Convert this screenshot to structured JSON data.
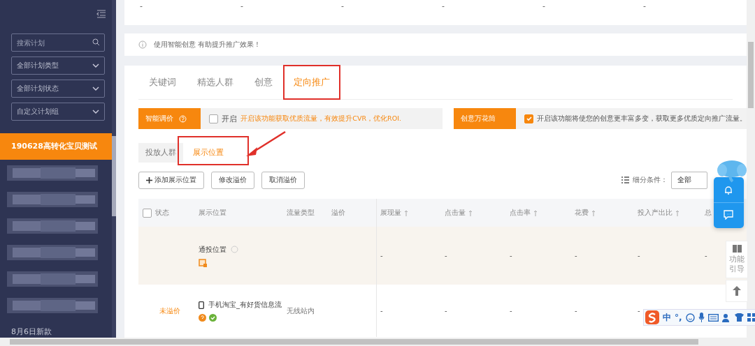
{
  "sidebar": {
    "search": {
      "placeholder": "搜索计划"
    },
    "filters": [
      "全部计划类型",
      "全部计划状态",
      "自定义计划组"
    ],
    "campaigns": [
      {
        "kind": "text",
        "name": "190628高转化宝贝测试",
        "selected": true
      },
      {
        "kind": "redacted"
      },
      {
        "kind": "redacted"
      },
      {
        "kind": "redacted"
      },
      {
        "kind": "redacted"
      },
      {
        "kind": "redacted"
      },
      {
        "kind": "redacted"
      },
      {
        "kind": "text",
        "name": "8月6日新款",
        "selected": false
      }
    ]
  },
  "summary_values": [
    "-",
    "-",
    "-",
    "-",
    "-",
    "-"
  ],
  "notice": "使用智能创意 有助提升推广效果！",
  "tabs": [
    {
      "label": "关键词",
      "selected": false
    },
    {
      "label": "精选人群",
      "selected": false
    },
    {
      "label": "创意",
      "selected": false
    },
    {
      "label": "定向推广",
      "selected": true
    }
  ],
  "smart_bid": {
    "label": "智能调价",
    "enabled": false,
    "toggle_label": "开启",
    "hint": "开启该功能获取优质流量，有效提升CVR，优化ROI."
  },
  "creative_kaleidoscope": {
    "label": "创意万花筒",
    "enabled": true,
    "hint": "开启该功能将使您的创意更丰富多变，获取更多优质定向推广流量。"
  },
  "sub_tabs": [
    {
      "label": "投放人群",
      "selected": false
    },
    {
      "label": "展示位置",
      "selected": true
    }
  ],
  "actions": [
    {
      "kind": "add",
      "label": "添加展示位置"
    },
    {
      "kind": "plain",
      "label": "修改溢价"
    },
    {
      "kind": "plain",
      "label": "取消溢价"
    }
  ],
  "segment": {
    "label": "细分条件：",
    "value": "全部"
  },
  "table": {
    "select_all_checked": false,
    "columns": [
      {
        "label": "状态",
        "sortable": false
      },
      {
        "label": "展示位置",
        "sortable": false
      },
      {
        "label": "流量类型",
        "sortable": false
      },
      {
        "label": "溢价",
        "sortable": false
      },
      {
        "label": "展现量",
        "sortable": true
      },
      {
        "label": "点击量",
        "sortable": true
      },
      {
        "label": "点击率",
        "sortable": true
      },
      {
        "label": "花费",
        "sortable": true
      },
      {
        "label": "投入产出比",
        "sortable": true
      },
      {
        "label": "总"
      }
    ],
    "rows": [
      {
        "kind": "general",
        "highlighted": true,
        "placement": "通投位置",
        "metrics": [
          "-",
          "-",
          "-",
          "-",
          "-",
          "-"
        ]
      },
      {
        "kind": "mobile",
        "highlighted": false,
        "status": "未溢价",
        "placement": "手机淘宝_有好货信息流",
        "traffic_type": "无线站内",
        "metrics": [
          "-",
          "-",
          "-",
          "-",
          "-"
        ]
      }
    ]
  },
  "guide": {
    "label": "功能引导"
  },
  "ime_bar": {
    "mode": "中",
    "punct": "°,"
  }
}
